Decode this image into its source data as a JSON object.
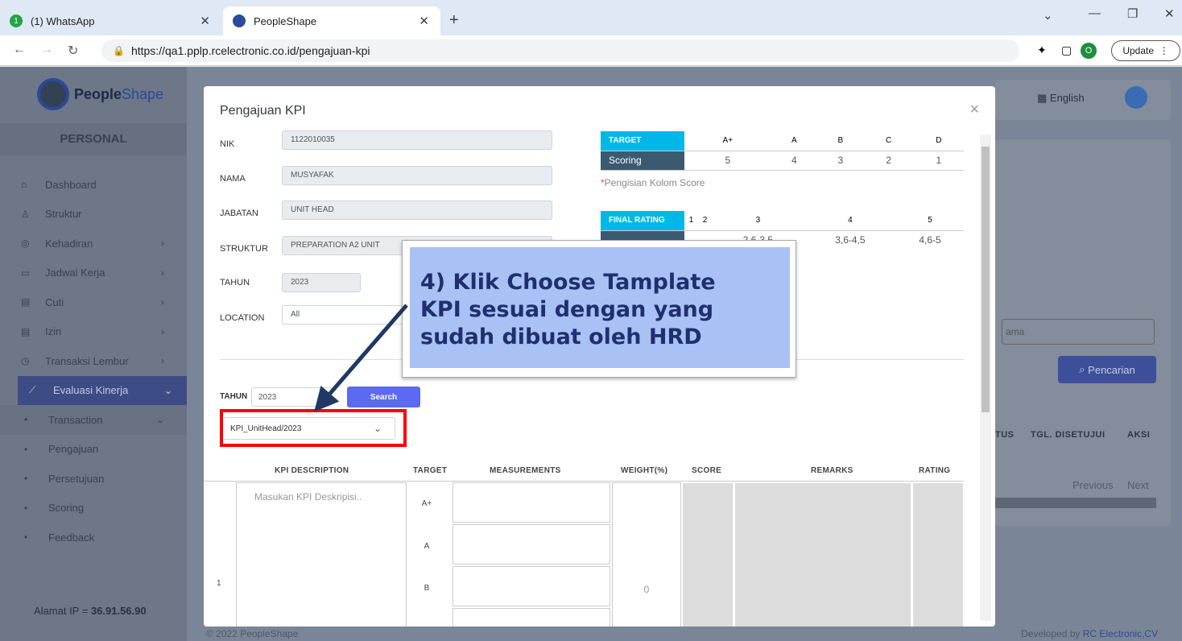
{
  "browser": {
    "tabs": [
      {
        "label": "(1) WhatsApp",
        "badge": "1"
      },
      {
        "label": "PeopleShape"
      }
    ],
    "url": "https://qa1.pplp.rcelectronic.co.id/pengajuan-kpi",
    "profile": "O",
    "update_label": "Update"
  },
  "app": {
    "logo_main": "People",
    "logo_accent": "Shape",
    "section": "PERSONAL",
    "menu": [
      {
        "label": "Dashboard"
      },
      {
        "label": "Struktur"
      },
      {
        "label": "Kehadiran"
      },
      {
        "label": "Jadwal Kerja"
      },
      {
        "label": "Cuti"
      },
      {
        "label": "Izin"
      },
      {
        "label": "Transaksi Lembur"
      },
      {
        "label": "Evaluasi Kinerja"
      },
      {
        "label": "Transaction"
      },
      {
        "label": "Pengajuan"
      },
      {
        "label": "Persetujuan"
      },
      {
        "label": "Scoring"
      },
      {
        "label": "Feedback"
      }
    ],
    "ip_label": "Alamat IP  =  ",
    "ip_value": "36.91.56.90",
    "language": "English",
    "search_placeholder": "ama",
    "search_button": "Pencarian",
    "headers": [
      "TUS",
      "TGL. DISETUJUI",
      "AKSI"
    ],
    "pagination": [
      "Previous",
      "Next"
    ],
    "footer_left": "© 2022 PeopleShape",
    "footer_right": "Developed by ",
    "footer_link": "RC Electronic,CV"
  },
  "modal": {
    "title": "Pengajuan KPI",
    "fields": [
      {
        "label": "NIK",
        "value": "1122010035"
      },
      {
        "label": "NAMA",
        "value": "MUSYAFAK"
      },
      {
        "label": "JABATAN",
        "value": "UNIT HEAD"
      },
      {
        "label": "STRUKTUR",
        "value": "PREPARATION A2 UNIT"
      },
      {
        "label": "TAHUN",
        "value": "2023"
      },
      {
        "label": "LOCATION",
        "value": "All"
      }
    ],
    "target_table": {
      "head": "TARGET",
      "grades": [
        "A+",
        "A",
        "B",
        "C",
        "D"
      ],
      "row_label": "Scoring",
      "scores": [
        "5",
        "4",
        "3",
        "2",
        "1"
      ]
    },
    "note_star": "*",
    "note": "Pengisian Kolom Score",
    "final_table": {
      "head": "FINAL RATING",
      "levels": [
        "1",
        "2",
        "3",
        "4",
        "5"
      ],
      "ranges": [
        "2,6-3,5",
        "3,6-4,5",
        "4,6-5"
      ]
    },
    "tahun_label": "TAHUN",
    "tahun_value": "2023",
    "search_label": "Search",
    "template_value": "KPI_UnitHead/2023",
    "columns": [
      "KPI DESCRIPTION",
      "TARGET",
      "MEASUREMENTS",
      "WEIGHT(%)",
      "SCORE",
      "REMARKS",
      "RATING"
    ],
    "row_no": "1",
    "desc_placeholder": "Masukan KPI Deskripisi..",
    "row_targets": [
      "A+",
      "A",
      "B"
    ],
    "weight": "0"
  },
  "callout": {
    "line1": "4) Klik Choose Tamplate",
    "line2": "KPI sesuai dengan yang",
    "line3": "sudah dibuat oleh HRD"
  },
  "colors": {
    "accent": "#5b6af0",
    "highlight": "#ff0000",
    "callout": "#a9c1f5",
    "arrow": "#1f3864"
  }
}
